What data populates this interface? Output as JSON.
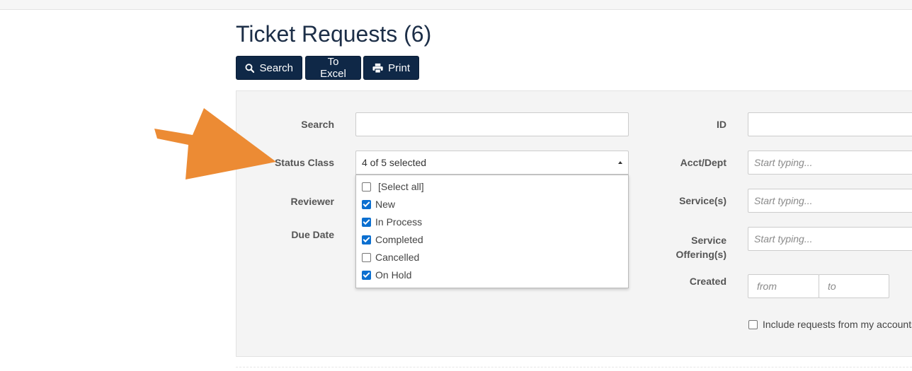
{
  "page": {
    "title": "Ticket Requests (6)"
  },
  "toolbar": {
    "search_label": "Search",
    "excel_label": "To Excel",
    "print_label": "Print"
  },
  "filters": {
    "search_label": "Search",
    "search_value": "",
    "status_class_label": "Status Class",
    "status_class_value": "4 of 5 selected",
    "reviewer_label": "Reviewer",
    "due_date_label": "Due Date",
    "id_label": "ID",
    "id_value": "",
    "acct_dept_label": "Acct/Dept",
    "acct_dept_placeholder": "Start typing...",
    "services_label": "Service(s)",
    "services_placeholder": "Start typing...",
    "service_offerings_label": "Service Offering(s)",
    "service_offerings_placeholder": "Start typing...",
    "created_label": "Created",
    "created_from_placeholder": "from",
    "created_to_placeholder": "to",
    "include_label": "Include requests from my accounts"
  },
  "status_options": [
    {
      "label": "[Select all]",
      "checked": false
    },
    {
      "label": "New",
      "checked": true
    },
    {
      "label": "In Process",
      "checked": true
    },
    {
      "label": "Completed",
      "checked": true
    },
    {
      "label": "Cancelled",
      "checked": false
    },
    {
      "label": "On Hold",
      "checked": true
    }
  ],
  "colors": {
    "primary_button": "#0f2847",
    "title": "#1c2e47",
    "checkbox_checked": "#0b6fd0",
    "annotation_arrow": "#ec8b34"
  }
}
